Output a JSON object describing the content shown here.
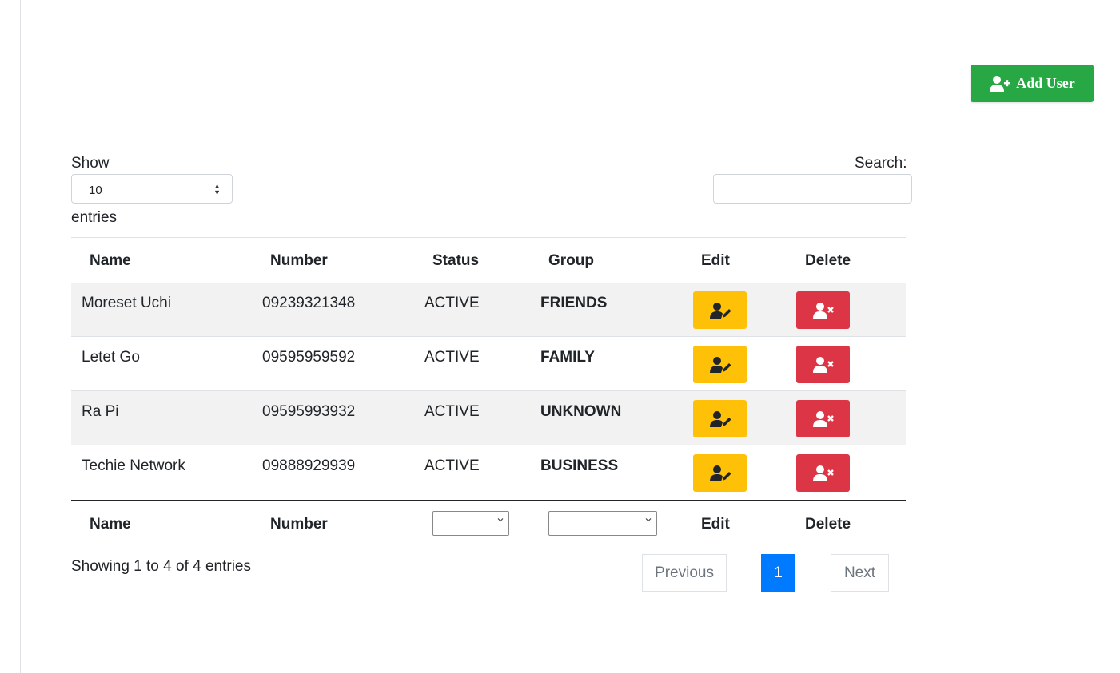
{
  "toolbar": {
    "add_user_label": "Add User"
  },
  "length_control": {
    "show_label": "Show",
    "value": "10",
    "entries_label": "entries"
  },
  "search": {
    "label": "Search:",
    "value": ""
  },
  "table": {
    "headers": [
      "Name",
      "Number",
      "Status",
      "Group",
      "Edit",
      "Delete"
    ],
    "rows": [
      {
        "name": "Moreset Uchi",
        "number": "09239321348",
        "status": "ACTIVE",
        "group": "FRIENDS"
      },
      {
        "name": "Letet Go",
        "number": "09595959592",
        "status": "ACTIVE",
        "group": "FAMILY"
      },
      {
        "name": "Ra Pi",
        "number": "09595993932",
        "status": "ACTIVE",
        "group": "UNKNOWN"
      },
      {
        "name": "Techie Network",
        "number": "09888929939",
        "status": "ACTIVE",
        "group": "BUSINESS"
      }
    ],
    "footer": {
      "name": "Name",
      "number": "Number",
      "status_filter": "",
      "group_filter": "",
      "edit": "Edit",
      "delete": "Delete"
    }
  },
  "info_text": "Showing 1 to 4 of 4 entries",
  "pagination": {
    "previous": "Previous",
    "current": "1",
    "next": "Next"
  },
  "icons": {
    "add": "user-plus-icon",
    "edit": "user-edit-icon",
    "delete": "user-times-icon",
    "sort": "sort-arrows-icon",
    "dropdown": "chevron-down-icon"
  },
  "colors": {
    "add": "#28a745",
    "edit": "#ffc107",
    "delete": "#dc3545",
    "page_active": "#007bff",
    "row_stripe": "#f2f2f2"
  }
}
